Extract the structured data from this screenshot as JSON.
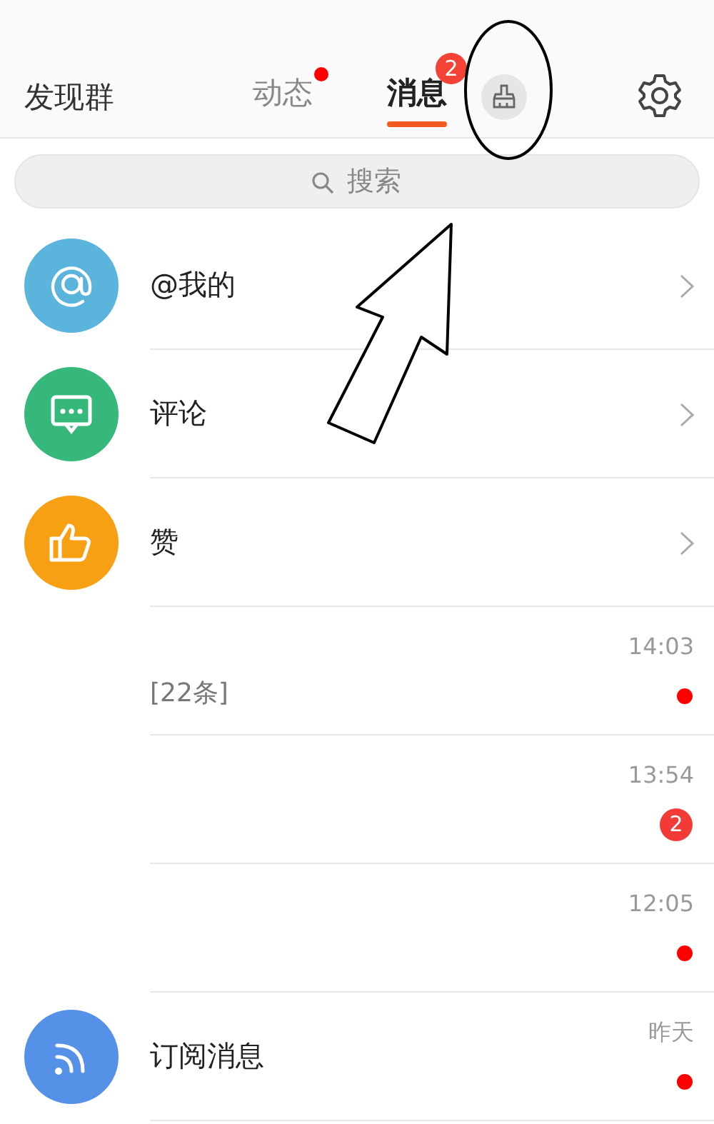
{
  "header": {
    "left_tab": "发现群",
    "tabs": [
      {
        "label": "动态",
        "selected": false,
        "dot": true
      },
      {
        "label": "消息",
        "selected": true,
        "badge": "2"
      }
    ]
  },
  "search": {
    "placeholder": "搜索"
  },
  "rows": [
    {
      "kind": "mention",
      "title": "@我的",
      "color": "#5ab4dc"
    },
    {
      "kind": "comment",
      "title": "评论",
      "color": "#35b879"
    },
    {
      "kind": "like",
      "title": "赞",
      "color": "#f7a013"
    },
    {
      "kind": "chat",
      "preview": "[22条]",
      "time": "14:03",
      "dot": true
    },
    {
      "kind": "chat",
      "time": "13:54",
      "badge": "2"
    },
    {
      "kind": "chat",
      "time": "12:05",
      "dot": true
    },
    {
      "kind": "subscription",
      "title": "订阅消息",
      "color": "#5591e6",
      "time": "昨天",
      "dot": true
    }
  ]
}
